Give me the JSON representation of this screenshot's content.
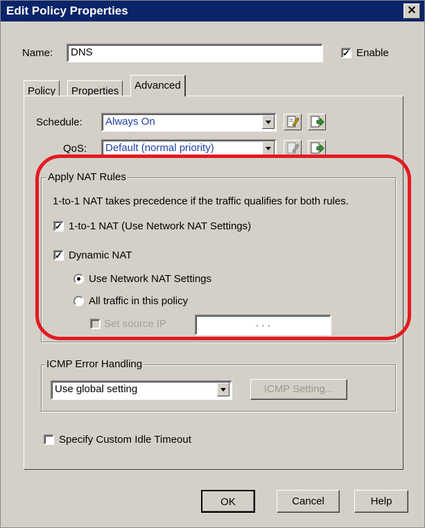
{
  "window": {
    "title": "Edit Policy Properties",
    "close_glyph": "✕"
  },
  "name_row": {
    "label": "Name:",
    "value": "DNS",
    "enable_label": "Enable",
    "enable_checked": true
  },
  "tabs": [
    {
      "label": "Policy",
      "active": false
    },
    {
      "label": "Properties",
      "active": false
    },
    {
      "label": "Advanced",
      "active": true
    }
  ],
  "schedule": {
    "label": "Schedule:",
    "value": "Always On",
    "edit_icon": "edit-icon",
    "add_icon": "add-icon"
  },
  "qos": {
    "label": "QoS:",
    "value": "Default (normal priority)",
    "edit_icon": "edit-icon",
    "add_icon": "add-icon"
  },
  "nat": {
    "group_label": "Apply NAT Rules",
    "note": "1-to-1 NAT takes precedence if the traffic qualifies for both rules.",
    "one_to_one_label": "1-to-1 NAT (Use Network NAT Settings)",
    "one_to_one_checked": true,
    "dynamic_label": "Dynamic NAT",
    "dynamic_checked": true,
    "use_network_label": "Use Network NAT Settings",
    "use_network_selected": true,
    "all_traffic_label": "All traffic in this policy",
    "all_traffic_selected": false,
    "set_source_label": "Set source IP",
    "source_ip_placeholder": ".       .       ."
  },
  "icmp": {
    "group_label": "ICMP Error Handling",
    "value": "Use global setting",
    "setting_button": "ICMP Setting..."
  },
  "idle_timeout": {
    "label": "Specify Custom Idle Timeout",
    "checked": false
  },
  "buttons": {
    "ok": "OK",
    "cancel": "Cancel",
    "help": "Help"
  },
  "colors": {
    "titlebar": "#0a246a",
    "dialog_bg": "#d4d0c8",
    "annotation": "#e21b22"
  }
}
